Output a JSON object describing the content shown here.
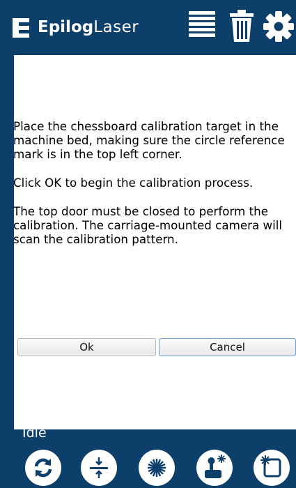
{
  "header": {
    "brand_bold": "Epilog",
    "brand_light": "Laser",
    "icons": [
      "logo-e-icon",
      "job-list-icon",
      "trash-icon",
      "gear-icon"
    ]
  },
  "dialog": {
    "paragraphs": [
      "Place the chessboard calibration target in the machine bed, making sure the circle reference mark is in the top left corner.",
      "Click OK to begin the calibration process.",
      "The top door must be closed to perform the calibration. The carriage-mounted camera will scan the calibration pattern."
    ],
    "ok_label": "Ok",
    "cancel_label": "Cancel"
  },
  "footer": {
    "status": "Idle",
    "buttons": [
      "refresh-icon",
      "focus-icon",
      "laser-fire-icon",
      "joystick-icon",
      "frame-icon"
    ]
  },
  "colors": {
    "brand_blue": "#0d3f6b",
    "panel_bg": "#ffffff",
    "cancel_border": "#6aa0d6"
  }
}
